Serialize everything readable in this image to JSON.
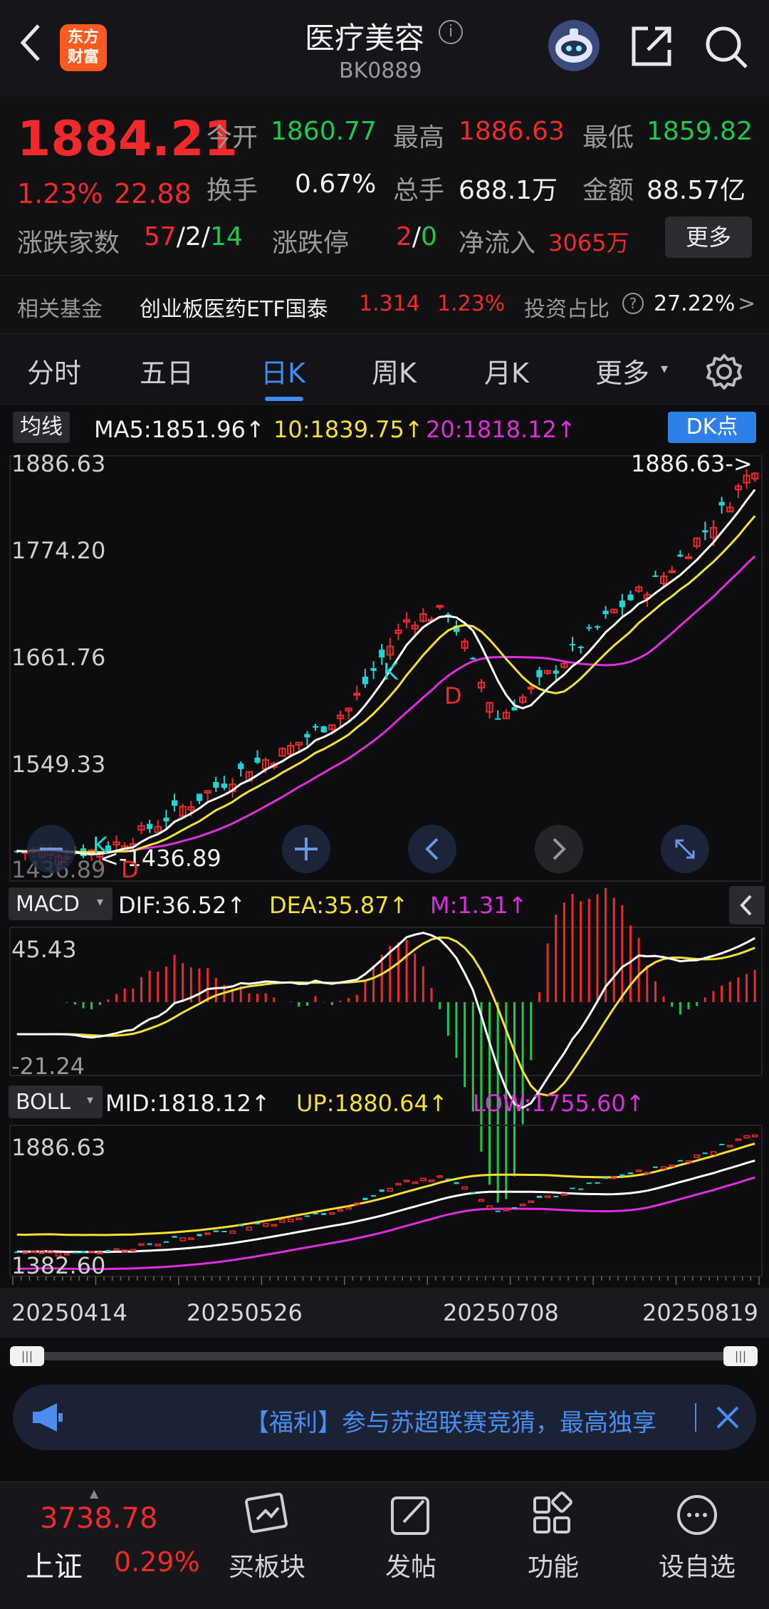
{
  "header": {
    "title": "医疗美容",
    "code": "BK0889",
    "logo_line1": "东方",
    "logo_line2": "财富"
  },
  "quote": {
    "price": "1884.21",
    "change_pct": "1.23%",
    "change": "22.88",
    "open_label": "今开",
    "open": "1860.77",
    "high_label": "最高",
    "high": "1886.63",
    "low_label": "最低",
    "low": "1859.82",
    "turnover_label": "换手",
    "turnover": "0.67%",
    "volume_label": "总手",
    "volume": "688.1万",
    "amount_label": "金额",
    "amount": "88.57亿",
    "breadth_label": "涨跌家数",
    "up": "57",
    "sep1": "/",
    "flat": "2",
    "sep2": "/",
    "down": "14",
    "limit_label": "涨跌停",
    "limit_up": "2",
    "sep3": "/",
    "limit_down": "0",
    "inflow_label": "净流入",
    "inflow": "3065万",
    "more_button": "更多"
  },
  "fund": {
    "label": "相关基金",
    "name": "创业板医药ETF国泰",
    "price": "1.314",
    "pct": "1.23%",
    "ratio_label": "投资占比",
    "ratio": "27.22%",
    "arrow": ">"
  },
  "tabs": [
    "分时",
    "五日",
    "日K",
    "周K",
    "月K",
    "更多"
  ],
  "active_tab": "日K",
  "ma": {
    "selector": "均线",
    "ma5": "MA5:1851.96↑",
    "ma10": "10:1839.75↑",
    "ma20": "20:1818.12↑",
    "dk_button": "DK点"
  },
  "kline": {
    "y_labels": [
      "1886.63",
      "1774.20",
      "1661.76",
      "1549.33",
      "1436.89"
    ],
    "high_marker": "1886.63->",
    "low_marker": "<-1436.89",
    "k_marker": "K",
    "d_marker": "D"
  },
  "macd": {
    "selector": "MACD",
    "dif": "DIF:36.52↑",
    "dea": "DEA:35.87↑",
    "m": "M:1.31↑",
    "y_top": "45.43",
    "y_bottom": "-21.24"
  },
  "boll": {
    "selector": "BOLL",
    "mid": "MID:1818.12↑",
    "up": "UP:1880.64↑",
    "low": "LOW:1755.60↑",
    "y_top": "1886.63",
    "y_bottom": "1382.60"
  },
  "dates": [
    "20250414",
    "20250526",
    "20250708",
    "20250819"
  ],
  "banner": {
    "text": "【福利】参与苏超联赛竞猜，最高独享"
  },
  "footer": {
    "index_value": "3738.78",
    "index_name": "上证",
    "index_pct": "0.29%",
    "buttons": [
      "买板块",
      "发帖",
      "功能",
      "设自选"
    ]
  },
  "colors": {
    "up": "#f02a2a",
    "down": "#1fd6d6",
    "ma5": "#ffffff",
    "ma10": "#f5e032",
    "ma20": "#e02de0",
    "accent": "#2f7fe8"
  },
  "chart_data": {
    "type": "candlestick",
    "price_axis": [
      1436.89,
      1886.63
    ],
    "latest_close": 1884.21,
    "latest_high": 1886.63,
    "period_low": 1436.89,
    "x_labels": [
      "20250414",
      "20250526",
      "20250708",
      "20250819"
    ]
  }
}
